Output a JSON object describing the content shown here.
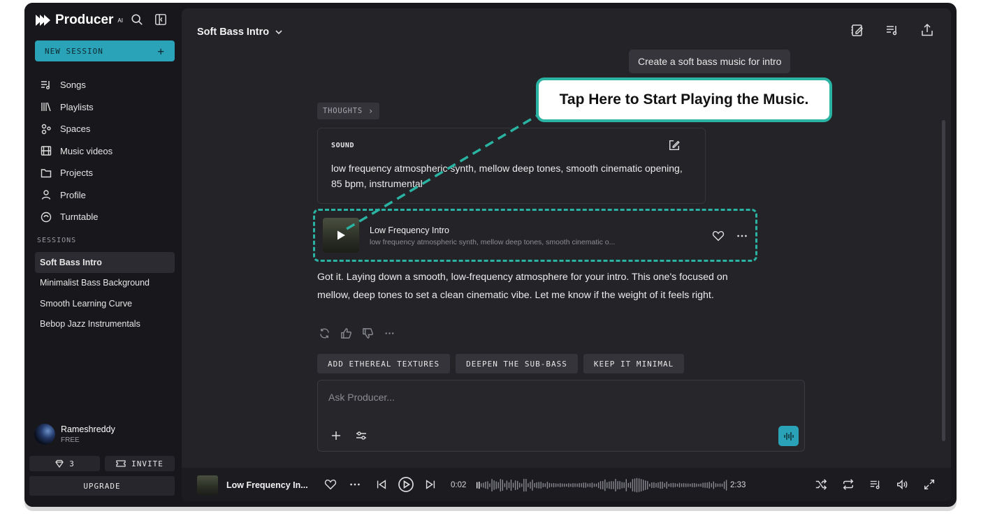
{
  "brand": {
    "name": "Producer",
    "suffix": "AI"
  },
  "sidebar": {
    "new_session_label": "NEW SESSION",
    "nav": [
      {
        "label": "Songs",
        "icon": "songs-icon"
      },
      {
        "label": "Playlists",
        "icon": "playlists-icon"
      },
      {
        "label": "Spaces",
        "icon": "spaces-icon"
      },
      {
        "label": "Music videos",
        "icon": "film-icon"
      },
      {
        "label": "Projects",
        "icon": "folder-icon"
      },
      {
        "label": "Profile",
        "icon": "user-icon"
      },
      {
        "label": "Turntable",
        "icon": "turntable-icon"
      }
    ],
    "sessions_heading": "SESSIONS",
    "sessions": [
      {
        "label": "Soft Bass Intro",
        "active": true
      },
      {
        "label": "Minimalist Bass Background"
      },
      {
        "label": "Smooth Learning Curve"
      },
      {
        "label": "Bebop Jazz Instrumentals"
      }
    ],
    "user": {
      "name": "Rameshreddy",
      "plan": "FREE"
    },
    "credits": "3",
    "invite_label": "INVITE",
    "upgrade_label": "UPGRADE"
  },
  "header": {
    "title": "Soft Bass Intro"
  },
  "chat": {
    "user_message": "Create a soft bass music for intro",
    "thoughts_label": "THOUGHTS",
    "sound": {
      "label": "SOUND",
      "text": "low frequency atmospheric synth, mellow deep tones, smooth cinematic opening, 85 bpm, instrumental"
    },
    "track": {
      "title": "Low Frequency Intro",
      "subtitle": "low frequency atmospheric synth, mellow deep tones, smooth cinematic o..."
    },
    "reply": "Got it. Laying down a smooth, low-frequency atmosphere for your intro. This one's focused on mellow, deep tones to set a clean cinematic vibe. Let me know if the weight of it feels right.",
    "suggestions": [
      "ADD ETHEREAL TEXTURES",
      "DEEPEN THE SUB-BASS",
      "KEEP IT MINIMAL"
    ],
    "composer_placeholder": "Ask Producer..."
  },
  "callout": {
    "text": "Tap Here to Start Playing the Music."
  },
  "player": {
    "title": "Low Frequency In...",
    "current_time": "0:02",
    "duration": "2:33",
    "progress": 0.013
  },
  "colors": {
    "accent": "#2aa3b8",
    "callout_border": "#2ab3a3",
    "background": "#18181c",
    "panel": "#232328"
  }
}
